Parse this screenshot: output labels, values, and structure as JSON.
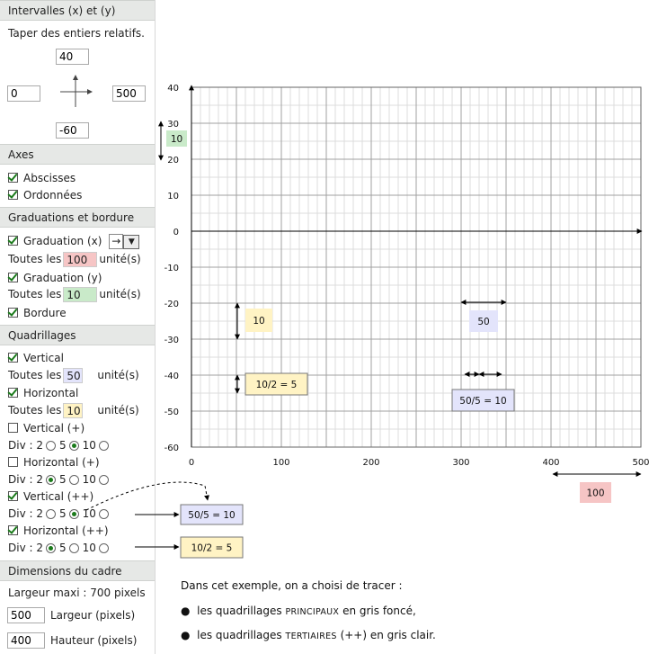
{
  "panel": {
    "intervals": {
      "title": "Intervalles (x) et (y)",
      "hint": "Taper des entiers relatifs.",
      "y_max": "40",
      "x_min": "0",
      "x_max": "500",
      "y_min": "-60"
    },
    "axes": {
      "title": "Axes",
      "abscisses": "Abscisses",
      "ordonnees": "Ordonnées"
    },
    "graduations": {
      "title": "Graduations et bordure",
      "grad_x_label": "Graduation (x)",
      "grad_x_arrow": "→",
      "every_label": "Toutes les",
      "unit_label": "unité(s)",
      "grad_x_value": "100",
      "grad_y_label": "Graduation (y)",
      "grad_y_value": "10",
      "border_label": "Bordure"
    },
    "grids": {
      "title": "Quadrillages",
      "vertical_label": "Vertical",
      "vertical_value": "50",
      "horizontal_label": "Horizontal",
      "horizontal_value": "10",
      "vertical_plus_label": "Vertical (+)",
      "horizontal_plus_label": "Horizontal (+)",
      "vertical_pp_label": "Vertical (++)",
      "horizontal_pp_label": "Horizontal (++)",
      "div_label": "Div : 2",
      "opt5": "5",
      "opt10": "10"
    },
    "frame": {
      "title": "Dimensions du cadre",
      "max_width": "Largeur maxi : 700 pixels",
      "width_value": "500",
      "width_label": "Largeur (pixels)",
      "height_value": "400",
      "height_label": "Hauteur (pixels)"
    }
  },
  "chart_data": {
    "type": "grid",
    "xlim": [
      0,
      500
    ],
    "ylim": [
      -60,
      40
    ],
    "x_ticks": [
      "0",
      "100",
      "200",
      "300",
      "400",
      "500"
    ],
    "y_ticks": [
      "40",
      "30",
      "20",
      "10",
      "0",
      "-10",
      "-20",
      "-30",
      "-40",
      "-50",
      "-60"
    ],
    "annotations": {
      "y_grad": "10",
      "x_grad": "100",
      "main_h": "10",
      "tert_h": "10/2 = 5",
      "main_v": "50",
      "tert_v": "50/5 = 10",
      "callout_v": "50/5 = 10",
      "callout_h": "10/2 = 5"
    },
    "colors": {
      "major_grid": "#a0a0a0",
      "minor_grid": "#dcdcdc",
      "green": "#c9eac9",
      "yellow": "#fff3c4",
      "blue": "#e3e4fb",
      "red": "#f6c5c5"
    }
  },
  "notes": {
    "intro": "Dans cet exemple, on a choisi de tracer :",
    "b1_a": "les quadrillages",
    "b1_b": "PRINCIPAUX",
    "b1_c": "en gris foncé,",
    "b2_a": "les quadrillages",
    "b2_b": "TERTIAIRES",
    "b2_c": "(++) en gris clair."
  }
}
